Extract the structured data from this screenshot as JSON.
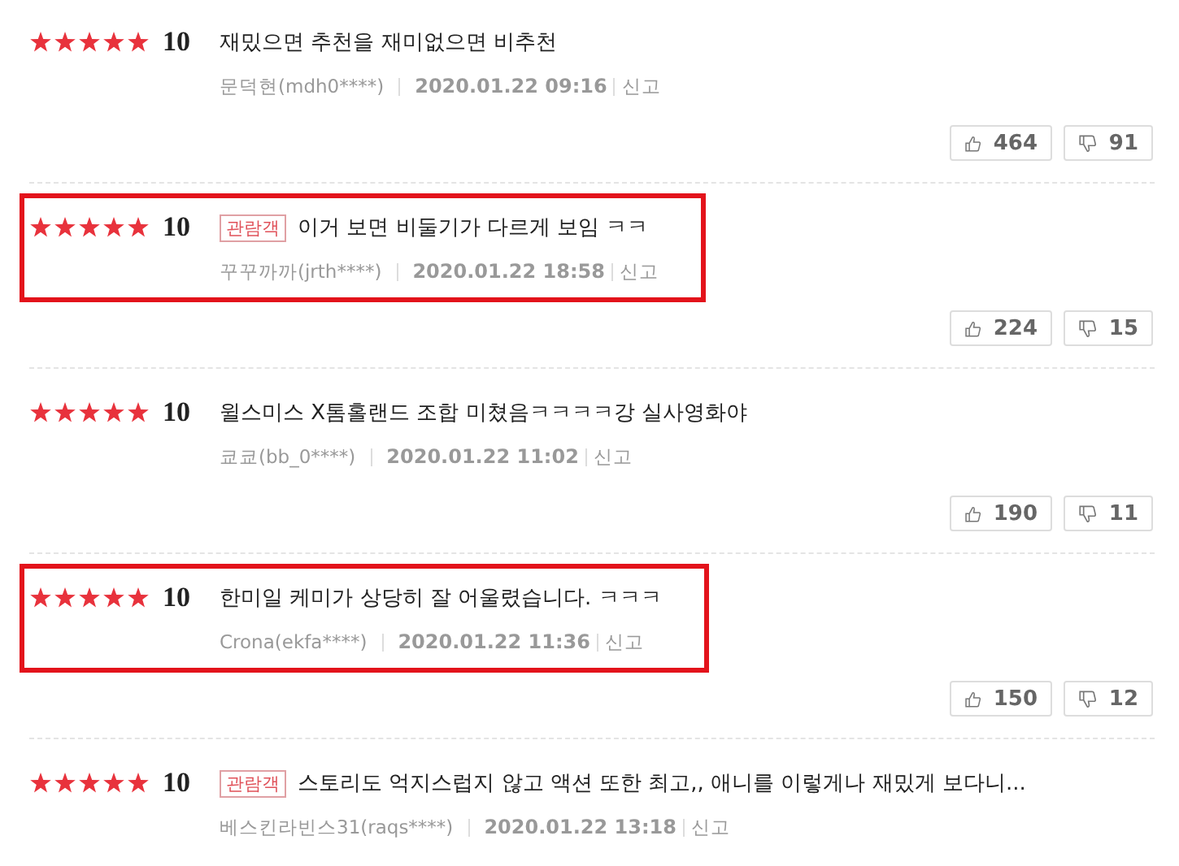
{
  "reviews": [
    {
      "stars": 5,
      "score": "10",
      "highlighted": false,
      "text": "재밌으면 추천을 재미없으면 비추천",
      "author": "문덕현(mdh0****)",
      "date": "2020.01.22 09:16",
      "report": "신고",
      "likes": "464",
      "dislikes": "91"
    },
    {
      "stars": 5,
      "score": "10",
      "highlighted": true,
      "badge": "관람객",
      "text": "이거 보면 비둘기가 다르게 보임 ㅋㅋ",
      "author": "꾸꾸까까(jrth****)",
      "date": "2020.01.22 18:58",
      "report": "신고",
      "likes": "224",
      "dislikes": "15"
    },
    {
      "stars": 5,
      "score": "10",
      "highlighted": false,
      "text": "윌스미스 X톰홀랜드 조합 미쳤음ㅋㅋㅋㅋ강 실사영화야",
      "author": "쿄쿄(bb_0****)",
      "date": "2020.01.22 11:02",
      "report": "신고",
      "likes": "190",
      "dislikes": "11"
    },
    {
      "stars": 5,
      "score": "10",
      "highlighted": true,
      "text": "한미일 케미가 상당히 잘 어울렸습니다. ㅋㅋㅋ",
      "author": "Crona(ekfa****)",
      "date": "2020.01.22 11:36",
      "report": "신고",
      "likes": "150",
      "dislikes": "12"
    },
    {
      "stars": 5,
      "score": "10",
      "highlighted": false,
      "badge": "관람객",
      "text": "스토리도 억지스럽지 않고 액션 또한 최고,, 애니를 이렇게나 재밌게 보다니...",
      "author": "베스킨라빈스31(raqs****)",
      "date": "2020.01.22 13:18",
      "report": "신고"
    }
  ]
}
